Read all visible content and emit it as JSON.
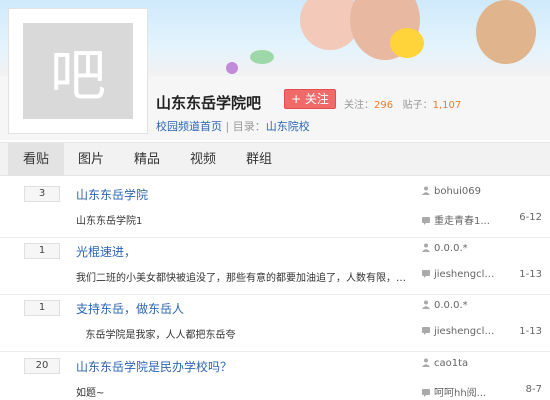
{
  "forum": {
    "avatar_char": "吧",
    "name": "山东东岳学院吧",
    "follow_label": "+ 关注",
    "follow_count_label": "关注：",
    "follow_count": "296",
    "post_count_label": "贴子：",
    "post_count": "1,107",
    "breadcrumb_channel": "校园频道首页",
    "breadcrumb_sep": " | 目录：",
    "breadcrumb_category": "山东院校"
  },
  "tabs": [
    {
      "label": "看贴",
      "active": true
    },
    {
      "label": "图片",
      "active": false
    },
    {
      "label": "精品",
      "active": false
    },
    {
      "label": "视频",
      "active": false
    },
    {
      "label": "群组",
      "active": false
    }
  ],
  "threads": [
    {
      "replies": "3",
      "title": "山东东岳学院",
      "abstract": "山东东岳学院1",
      "author": "bohui069",
      "last_reply_user": "重走青春1...",
      "last_reply_time": "6-12"
    },
    {
      "replies": "1",
      "title": "光棍速进，",
      "abstract": "我们二班的小美女都快被追没了，那些有意的都要加油追了，人数有限，速来竞争哈...",
      "author": "0.0.0.*",
      "last_reply_user": "jieshengclub",
      "last_reply_time": "1-13"
    },
    {
      "replies": "1",
      "title": "支持东岳，做东岳人",
      "abstract": "   东岳学院是我家，人人都把东岳夸",
      "author": "0.0.0.*",
      "last_reply_user": "jieshengclub",
      "last_reply_time": "1-13"
    },
    {
      "replies": "20",
      "title": "山东东岳学院是民办学校吗？",
      "abstract": "如题~",
      "author": "cao1ta",
      "last_reply_user": "呵呵hh阅...",
      "last_reply_time": "8-7"
    }
  ],
  "colors": {
    "link": "#2d64b3",
    "follow": "#f06a6a",
    "stat_number": "#e87d31"
  },
  "icons": {
    "author": "user-icon",
    "last_reply": "comment-icon"
  }
}
